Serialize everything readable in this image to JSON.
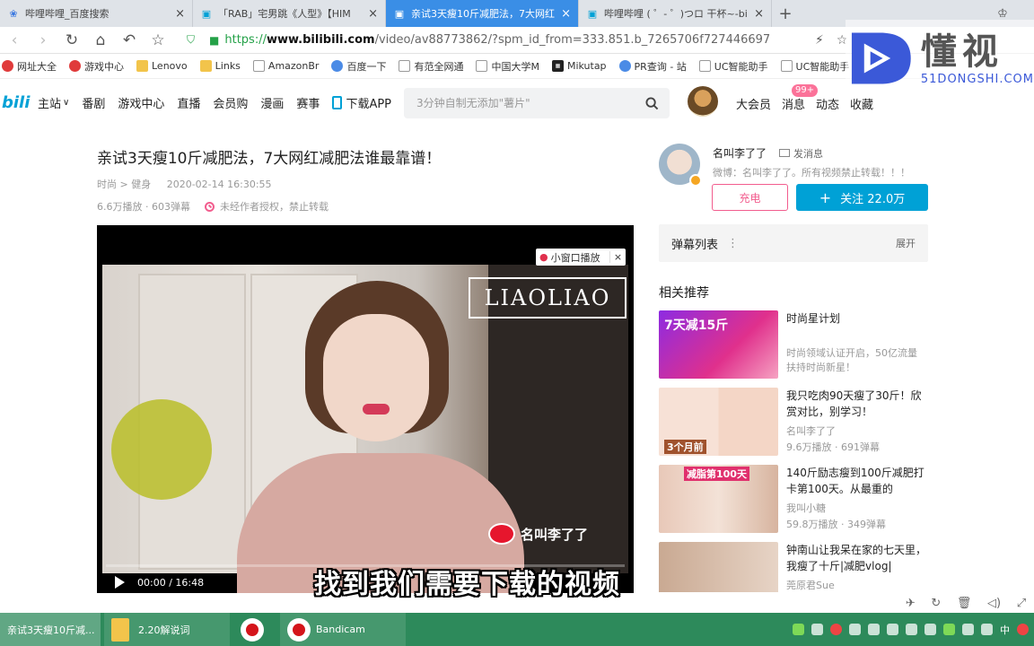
{
  "tabs": [
    {
      "icon": "paw-icon",
      "title": "哔哩哔哩_百度搜索",
      "active": false
    },
    {
      "icon": "tv-icon",
      "title": "「RAB」宅男跳《人型》【HIM",
      "active": false
    },
    {
      "icon": "tv-icon",
      "title": "亲试3天瘦10斤减肥法，7大网红",
      "active": true
    },
    {
      "icon": "tv-icon",
      "title": "哔哩哔哩 ( ゜- ゜)つロ 干杯~-bi",
      "active": false
    }
  ],
  "address": {
    "scheme": "https://",
    "host": "www.bilibili.com",
    "path": "/video/av88773862/?spm_id_from=333.851.b_7265706f727446697"
  },
  "bookmarks": [
    {
      "label": "网址大全",
      "icon": "red"
    },
    {
      "label": "游戏中心",
      "icon": "red"
    },
    {
      "label": "Lenovo",
      "icon": "folder"
    },
    {
      "label": "Links",
      "icon": "folder"
    },
    {
      "label": "AmazonBr",
      "icon": "doc"
    },
    {
      "label": "百度一下",
      "icon": "blue"
    },
    {
      "label": "有范全网通",
      "icon": "doc"
    },
    {
      "label": "中国大学M",
      "icon": "doc"
    },
    {
      "label": "Mikutap",
      "icon": "dark"
    },
    {
      "label": "PR查询 - 站",
      "icon": "blue"
    },
    {
      "label": "UC智能助手",
      "icon": "doc"
    },
    {
      "label": "UC智能助手",
      "icon": "doc"
    }
  ],
  "watermark": {
    "cn": "懂视",
    "en": "51DONGSHI.COM"
  },
  "bili_header": {
    "logo": "bili",
    "nav": [
      "主站",
      "番剧",
      "游戏中心",
      "直播",
      "会员购",
      "漫画",
      "赛事",
      "下载APP"
    ],
    "search_placeholder": "3分钟自制无添加\"薯片\"",
    "right": [
      "大会员",
      "消息",
      "动态",
      "收藏"
    ],
    "badge": "99+"
  },
  "video": {
    "title": "亲试3天瘦10斤减肥法，7大网红减肥法谁最靠谱！",
    "category": "时尚 > 健身",
    "date": "2020-02-14 16:30:55",
    "plays": "6.6万播放 · 603弹幕",
    "notice": "未经作者授权，禁止转载",
    "logo": "LIAOLIAO",
    "pip": "小窗口播放",
    "weibo": "名叫李了了",
    "time": "00:00 / 16:48",
    "subtitle": "找到我们需要下载的视频"
  },
  "uploader": {
    "name": "名叫李了了",
    "message": "发消息",
    "sign": "微博：名叫李了了。所有视频禁止转载！！！",
    "charge": "充电",
    "follow": "关注 22.0万"
  },
  "danmaku": {
    "label": "弹幕列表",
    "expand": "展开"
  },
  "recommend": {
    "title": "相关推荐",
    "items": [
      {
        "title": "时尚星计划",
        "author": "时尚领域认证开启，50亿流量扶持时尚新星！",
        "stats": "",
        "thumb": "7天减15斤"
      },
      {
        "title": "我只吃肉90天瘦了30斤！欣赏对比，别学习！",
        "author": "名叫李了了",
        "stats": "9.6万播放 · 691弹幕",
        "thumb": "3个月前"
      },
      {
        "title": "140斤励志瘦到100斤减肥打卡第100天。从最重的",
        "author": "我叫小糖",
        "stats": "59.8万播放 · 349弹幕",
        "thumb": "减脂第100天"
      },
      {
        "title": "钟南山让我呆在家的七天里，我瘦了十斤|减肥vlog|",
        "author": "莞原君Sue",
        "stats": "",
        "thumb": ""
      }
    ]
  },
  "taskbar": {
    "items": [
      "亲试3天瘦10斤减...",
      "2.20解说词",
      "",
      "Bandicam"
    ],
    "tray_text": "中"
  }
}
